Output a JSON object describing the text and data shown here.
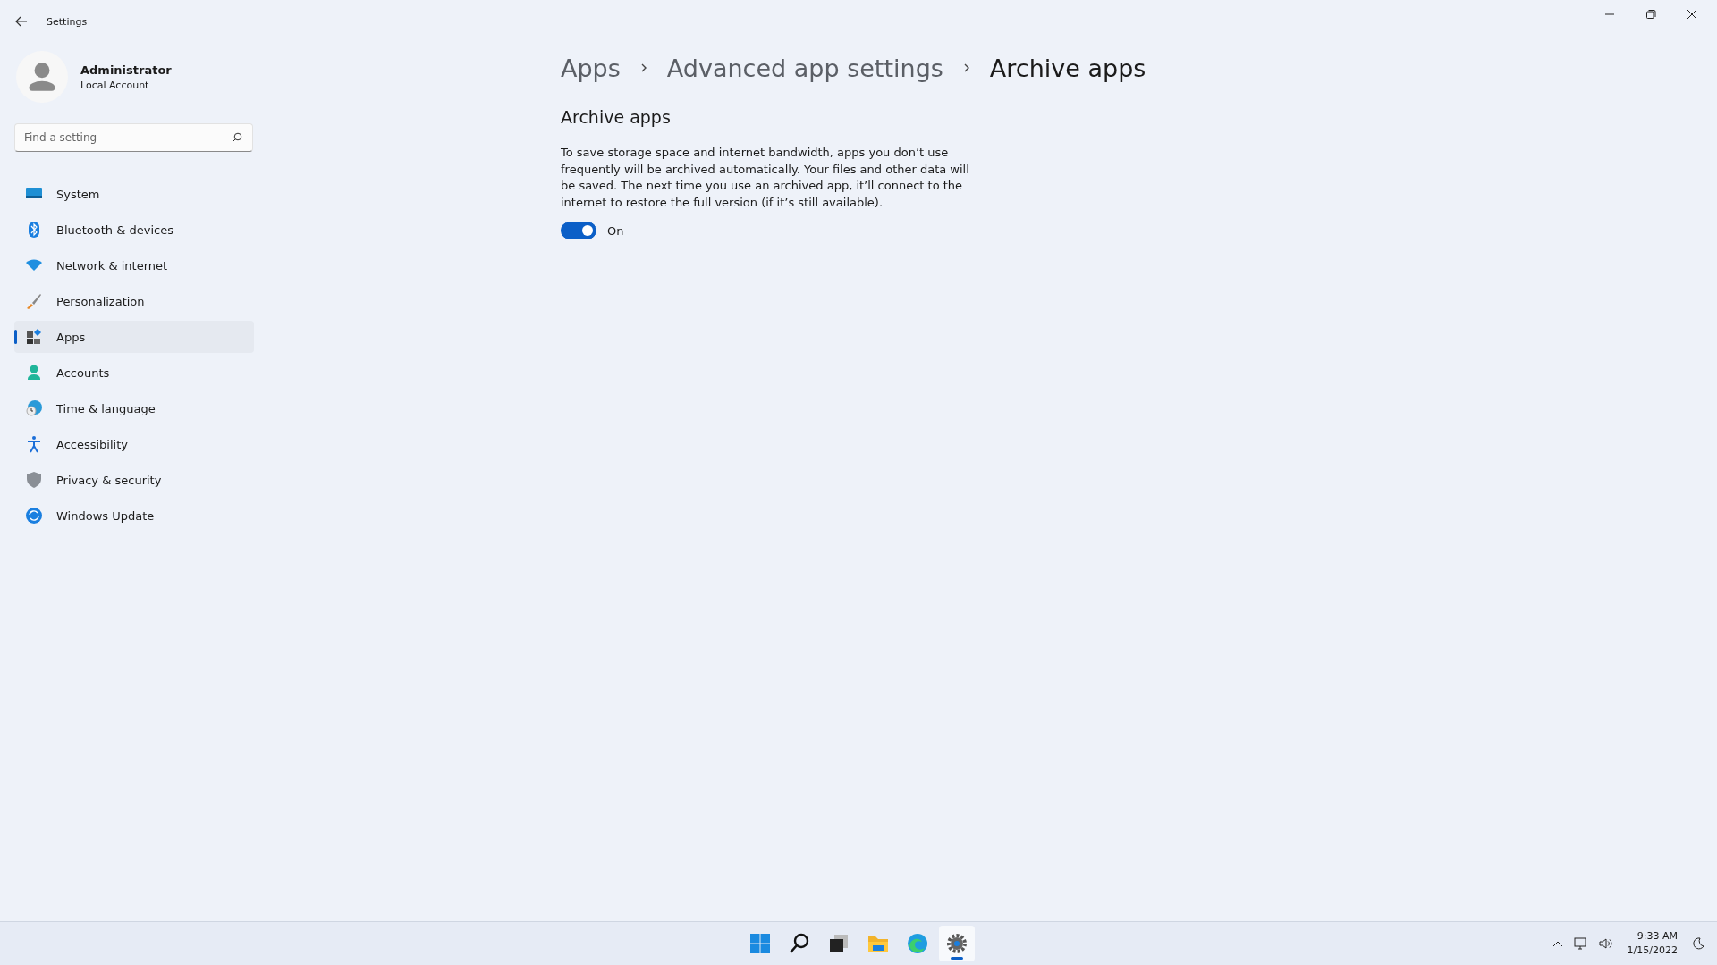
{
  "window": {
    "title": "Settings"
  },
  "user": {
    "name": "Administrator",
    "account_type": "Local Account"
  },
  "search": {
    "placeholder": "Find a setting"
  },
  "nav": [
    {
      "label": "System",
      "selected": false
    },
    {
      "label": "Bluetooth & devices",
      "selected": false
    },
    {
      "label": "Network & internet",
      "selected": false
    },
    {
      "label": "Personalization",
      "selected": false
    },
    {
      "label": "Apps",
      "selected": true
    },
    {
      "label": "Accounts",
      "selected": false
    },
    {
      "label": "Time & language",
      "selected": false
    },
    {
      "label": "Accessibility",
      "selected": false
    },
    {
      "label": "Privacy & security",
      "selected": false
    },
    {
      "label": "Windows Update",
      "selected": false
    }
  ],
  "breadcrumb": [
    {
      "label": "Apps",
      "current": false
    },
    {
      "label": "Advanced app settings",
      "current": false
    },
    {
      "label": "Archive apps",
      "current": true
    }
  ],
  "section": {
    "title": "Archive apps",
    "description": "To save storage space and internet bandwidth, apps you don’t use frequently will be archived automatically. Your files and other data will be saved. The next time you use an archived app, it’ll connect to the internet to restore the full version (if it’s still available).",
    "toggle": {
      "on": true,
      "label": "On"
    }
  },
  "taskbar": {
    "apps": [
      {
        "selected": false
      },
      {
        "selected": false
      },
      {
        "selected": false
      },
      {
        "selected": false
      },
      {
        "selected": false
      },
      {
        "selected": true
      }
    ],
    "clock": {
      "time": "9:33 AM",
      "date": "1/15/2022"
    }
  }
}
